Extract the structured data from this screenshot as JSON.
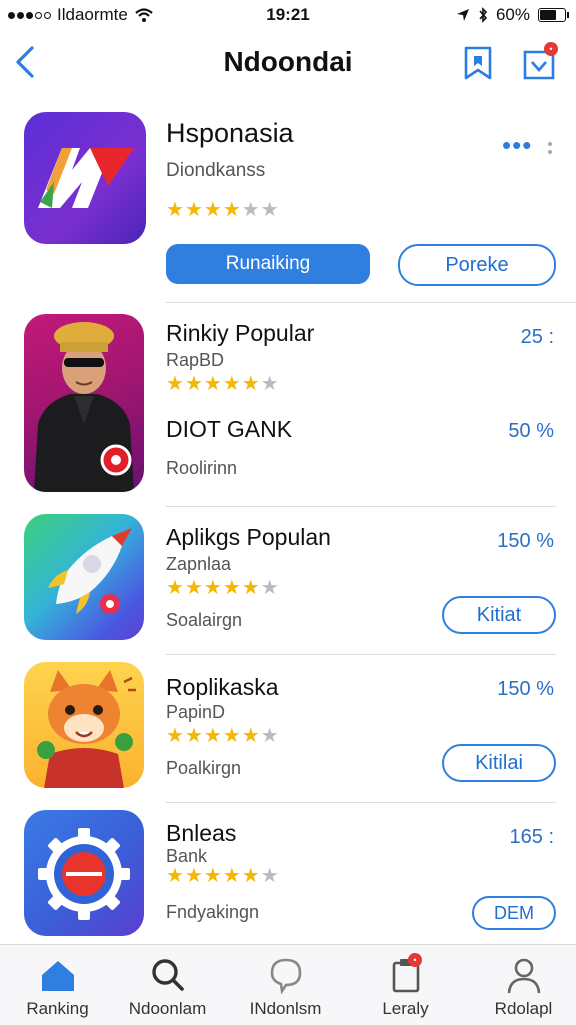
{
  "status": {
    "carrier": "Ildaormte",
    "time": "19:21",
    "battery": "60%"
  },
  "nav": {
    "title": "Ndoondai"
  },
  "featured": {
    "title": "Hsponasia",
    "subtitle": "Diondkanss",
    "rating": 3.5,
    "primary_label": "Runaiking",
    "secondary_label": "Poreke",
    "accent": "#2f7fe0"
  },
  "list": [
    {
      "title": "Rinkiy Popular",
      "subtitle": "RapBD",
      "rating": 4.5,
      "extra_title": "DIOT GANK",
      "extra_pct": "50 %",
      "footer": "Roolirinn",
      "pct": "25 :"
    },
    {
      "title": "Aplikgs Populan",
      "subtitle": "Zapnlaa",
      "rating": 4.5,
      "footer": "Soalairgn",
      "pct": "150 %",
      "button": "Kitiat"
    },
    {
      "title": "Roplikaska",
      "subtitle": "PapinD",
      "rating": 4.5,
      "footer": "Poalkirgn",
      "pct": "150 %",
      "button": "Kitilai"
    },
    {
      "title": "Bnleas",
      "subtitle": "Bank",
      "rating": 4.5,
      "footer": "Fndyakingn",
      "pct": "165 :",
      "button": "DEM"
    }
  ],
  "tabs": [
    {
      "label": "Ranking",
      "icon": "home-icon"
    },
    {
      "label": "Ndoonlam",
      "icon": "search-icon"
    },
    {
      "label": "INdonlsm",
      "icon": "chat-icon"
    },
    {
      "label": "Leraly",
      "icon": "clipboard-icon"
    },
    {
      "label": "Rdolapl",
      "icon": "profile-icon"
    }
  ]
}
